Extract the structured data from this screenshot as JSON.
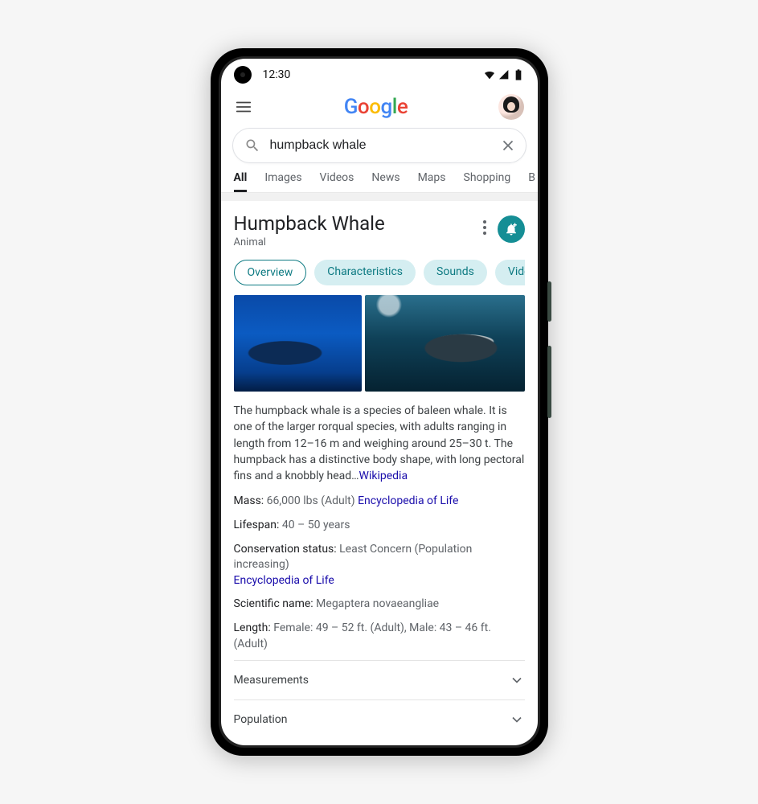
{
  "status": {
    "time": "12:30"
  },
  "logo": {
    "g1": "G",
    "g2": "o",
    "g3": "o",
    "g4": "g",
    "g5": "l",
    "g6": "e"
  },
  "search": {
    "query": "humpback whale"
  },
  "tabs": [
    "All",
    "Images",
    "Videos",
    "News",
    "Maps",
    "Shopping",
    "B"
  ],
  "card": {
    "title": "Humpback Whale",
    "subtitle": "Animal",
    "chips": [
      "Overview",
      "Characteristics",
      "Sounds",
      "Videos"
    ],
    "description": "The humpback whale is a species of baleen whale. It is one of the larger rorqual species, with adults ranging in length from 12–16 m and weighing around 25–30 t. The humpback has a distinctive body shape, with long pectoral fins and a knobbly head…",
    "description_source": "Wikipedia",
    "facts": {
      "mass": {
        "label": "Mass:",
        "value": "66,000 lbs (Adult)",
        "source": "Encyclopedia of Life"
      },
      "lifespan": {
        "label": "Lifespan:",
        "value": "40 – 50 years"
      },
      "conserv": {
        "label": "Conservation status:",
        "value": "Least Concern (Population increasing)",
        "source": "Encyclopedia of Life"
      },
      "scientific": {
        "label": "Scientific name:",
        "value": "Megaptera novaeangliae"
      },
      "length": {
        "label": "Length:",
        "value": "Female: 49 – 52 ft. (Adult), Male: 43 – 46 ft. (Adult)"
      }
    },
    "accordion": [
      "Measurements",
      "Population"
    ]
  }
}
